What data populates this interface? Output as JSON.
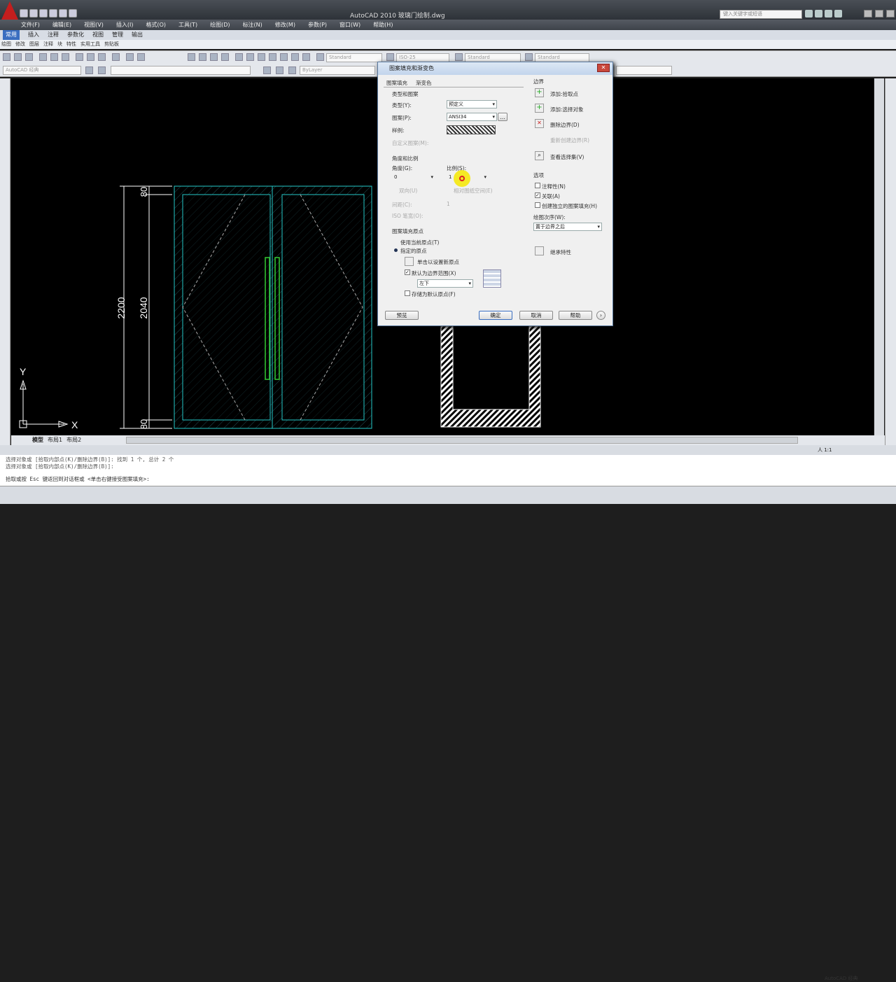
{
  "app": {
    "title": "AutoCAD 2010    玻璃门绘制.dwg",
    "search_placeholder": "键入关键字或短语"
  },
  "menu": [
    "文件(F)",
    "编辑(E)",
    "视图(V)",
    "插入(I)",
    "格式(O)",
    "工具(T)",
    "绘图(D)",
    "标注(N)",
    "修改(M)",
    "参数(P)",
    "窗口(W)",
    "帮助(H)"
  ],
  "ribbon_tabs": [
    "常用",
    "插入",
    "注释",
    "参数化",
    "视图",
    "管理",
    "输出"
  ],
  "panels": [
    "绘图",
    "修改",
    "图层",
    "注释",
    "块",
    "特性",
    "实用工具",
    "剪贴板"
  ],
  "toolbar": {
    "workspace": "AutoCAD 经典",
    "text_style": "Standard",
    "dim_style": "ISO-25",
    "table_style": "Standard",
    "mleader_style": "Standard",
    "layer": "ByLayer"
  },
  "drawing": {
    "dim_total": "2200",
    "dim_inner": "2040",
    "dim_top": "80",
    "dim_bottom": "80",
    "ucs_y": "Y",
    "ucs_x": "X"
  },
  "layout_tabs": [
    "模型",
    "布局1",
    "布局2"
  ],
  "dialog": {
    "title": "图案填充和渐变色",
    "tab_hatch": "图案填充",
    "tab_gradient": "渐变色",
    "group_type_pattern": "类型和图案",
    "type_label": "类型(Y):",
    "type_value": "预定义",
    "pattern_label": "图案(P):",
    "pattern_value": "ANSI34",
    "sample_label": "样例:",
    "custom_label": "自定义图案(M):",
    "group_angle_scale": "角度和比例",
    "angle_label": "角度(G):",
    "angle_value": "0",
    "scale_label": "比例(S):",
    "scale_value": "1",
    "double_label": "双向(U)",
    "relative_label": "相对图纸空间(E)",
    "spacing_label": "间距(C):",
    "spacing_value": "1",
    "iso_label": "ISO 笔宽(O):",
    "group_origin": "图案填充原点",
    "use_current_origin": "使用当前原点(T)",
    "specified_origin": "指定的原点",
    "click_set_origin": "单击以设置新原点",
    "default_boundary": "默认为边界范围(X)",
    "boundary_pos": "左下",
    "store_default": "存储为默认原点(F)",
    "group_boundary": "边界",
    "add_pick": "添加:拾取点",
    "add_select": "添加:选择对象",
    "remove_boundary": "删除边界(D)",
    "recreate_boundary": "重新创建边界(R)",
    "view_selection": "查看选择集(V)",
    "group_options": "选项",
    "annotative": "注释性(N)",
    "associative": "关联(A)",
    "separate": "创建独立的图案填充(H)",
    "draw_order_label": "绘图次序(W):",
    "draw_order_value": "置于边界之后",
    "inherit": "继承特性",
    "preview": "预览",
    "ok": "确定",
    "cancel": "取消",
    "help": "帮助"
  },
  "command_lines": [
    "选择对象或 [拾取内部点(K)/删除边界(B)]: 找到 1 个, 总计 2 个",
    "选择对象或 [拾取内部点(K)/删除边界(B)]:",
    "拾取或按 Esc 键返回到对话框或 <单击右键接受图案填充>:"
  ],
  "status": {
    "annotation_scale": "人 1:1",
    "workspace": "AutoCAD 经典"
  }
}
